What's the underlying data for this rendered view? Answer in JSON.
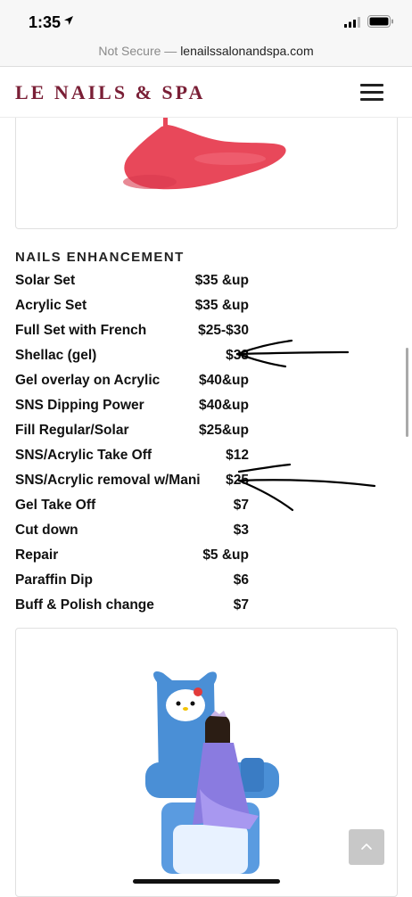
{
  "status": {
    "time": "1:35"
  },
  "browser": {
    "insecure_label": "Not Secure — ",
    "domain": "lenailssalonandspa.com"
  },
  "site": {
    "logo": "LE NAILS & SPA"
  },
  "section": {
    "title": "NAILS ENHANCEMENT",
    "items": [
      {
        "name": "Solar Set",
        "price": "$35 &up"
      },
      {
        "name": "Acrylic Set",
        "price": "$35 &up"
      },
      {
        "name": "Full Set with French",
        "price": "$25-$30"
      },
      {
        "name": "Shellac (gel)",
        "price": "$33"
      },
      {
        "name": "Gel overlay on Acrylic",
        "price": "$40&up"
      },
      {
        "name": "SNS Dipping Power",
        "price": "$40&up"
      },
      {
        "name": "Fill Regular/Solar",
        "price": "$25&up"
      },
      {
        "name": "SNS/Acrylic Take Off",
        "price": "$12"
      },
      {
        "name": "SNS/Acrylic removal w/Mani",
        "price": "$25"
      },
      {
        "name": "Gel Take Off",
        "price": "$7"
      },
      {
        "name": "Cut down",
        "price": "$3"
      },
      {
        "name": "Repair",
        "price": "$5 &up"
      },
      {
        "name": "Paraffin Dip",
        "price": "$6"
      },
      {
        "name": "Buff & Polish change",
        "price": "$7"
      }
    ]
  },
  "icons": {
    "location": "location-arrow-icon",
    "signal": "cellular-signal-icon",
    "battery": "battery-icon",
    "menu": "hamburger-menu-icon",
    "back_to_top": "chevron-up-icon"
  },
  "colors": {
    "brand": "#7a1f36",
    "polish": "#e8485a",
    "chair": "#4a8fd6"
  }
}
